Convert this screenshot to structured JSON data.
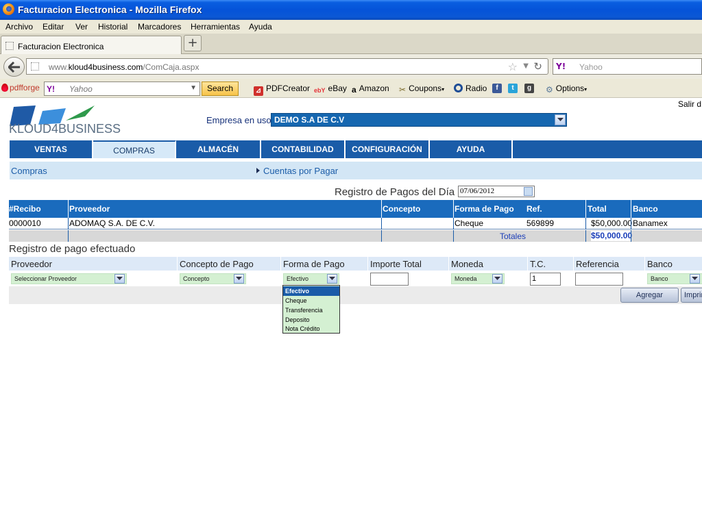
{
  "browser": {
    "window_title": "Facturacion Electronica - Mozilla Firefox",
    "menu": [
      "Archivo",
      "Editar",
      "Ver",
      "Historial",
      "Marcadores",
      "Herramientas",
      "Ayuda"
    ],
    "tab_label": "Facturacion Electronica",
    "url_prefix": "www.",
    "url_domain": "kloud4business.com",
    "url_path": "/ComCaja.aspx",
    "search_placeholder": "Yahoo",
    "yahoo_logo": "Y!"
  },
  "toolbar": {
    "pdfforge": "pdfforge",
    "search_placeholder": "Yahoo",
    "search_button": "Search",
    "items": [
      "PDFCreator",
      "eBay",
      "Amazon",
      "Coupons",
      "Radio",
      "Options"
    ]
  },
  "page": {
    "logo_text": "KLOUD4BUSINESS",
    "salir": "Salir d",
    "empresa_label": "Empresa en uso:",
    "empresa_value": "DEMO S.A DE C.V",
    "nav": [
      "VENTAS",
      "COMPRAS",
      "ALMACÉN",
      "CONTABILIDAD",
      "CONFIGURACIÓN",
      "AYUDA"
    ],
    "nav_active": "COMPRAS",
    "breadcrumb_1": "Compras",
    "breadcrumb_2": "Cuentas por Pagar",
    "registro_title": "Registro de Pagos del Día",
    "registro_date": "07/06/2012",
    "grid": {
      "headers": [
        "#Recibo",
        "Proveedor",
        "Concepto",
        "Forma de Pago",
        "Ref.",
        "Total",
        "Banco"
      ],
      "row": [
        "0000010",
        "ADOMAQ S.A. DE C.V.",
        "",
        "Cheque",
        "569899",
        "$50,000.00",
        "Banamex"
      ],
      "totales_label": "Totales",
      "totales_value": "$50,000.00"
    },
    "pago_title": "Registro de pago efectuado",
    "form": {
      "headers": [
        "Proveedor",
        "Concepto de Pago",
        "Forma de Pago",
        "Importe Total",
        "Moneda",
        "T.C.",
        "Referencia",
        "Banco"
      ],
      "proveedor": "Seleccionar Proveedor",
      "concepto": "Concepto",
      "forma_pago": "Efectivo",
      "importe": "",
      "moneda": "Moneda",
      "tc": "1",
      "referencia": "",
      "banco": "Banco"
    },
    "forma_pago_options": [
      "Efectivo",
      "Cheque",
      "Transferencia",
      "Deposito",
      "Nota Crédito"
    ],
    "buttons": {
      "agregar": "Agregar",
      "imprimir": "Imprim"
    }
  },
  "colors": {
    "nav_blue": "#1a5ca8",
    "grid_header": "#1a6bbd",
    "select_green": "#d4f0d2",
    "subnav_bg": "#d3e6f5"
  }
}
